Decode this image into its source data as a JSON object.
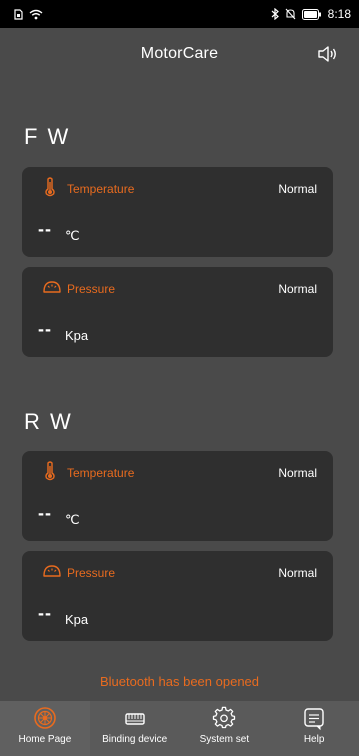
{
  "status_bar": {
    "time": "8:18",
    "icons": [
      "sim-icon",
      "wifi-icon",
      "bluetooth-icon",
      "mute-icon",
      "battery-icon"
    ]
  },
  "header": {
    "title": "MotorCare",
    "sound_icon": "speaker-icon"
  },
  "front_wheel": {
    "title": "F W",
    "temperature": {
      "label": "Temperature",
      "status": "Normal",
      "value": "--",
      "unit": "℃",
      "icon": "thermometer-icon"
    },
    "pressure": {
      "label": "Pressure",
      "status": "Normal",
      "value": "--",
      "unit": "Kpa",
      "icon": "gauge-icon"
    }
  },
  "rear_wheel": {
    "title": "R W",
    "temperature": {
      "label": "Temperature",
      "status": "Normal",
      "value": "--",
      "unit": "℃",
      "icon": "thermometer-icon"
    },
    "pressure": {
      "label": "Pressure",
      "status": "Normal",
      "value": "--",
      "unit": "Kpa",
      "icon": "gauge-icon"
    }
  },
  "bluetooth_status": "Bluetooth has been opened",
  "nav": {
    "items": [
      {
        "label": "Home Page",
        "icon": "home-wheel-icon",
        "active": true
      },
      {
        "label": "Binding device",
        "icon": "device-icon",
        "active": false
      },
      {
        "label": "System set",
        "icon": "gear-icon",
        "active": false
      },
      {
        "label": "Help",
        "icon": "help-icon",
        "active": false
      }
    ]
  },
  "colors": {
    "accent": "#e86b1f",
    "background": "#4a4a4a",
    "card": "#2f2f2f",
    "nav": "#5a5a5a"
  }
}
